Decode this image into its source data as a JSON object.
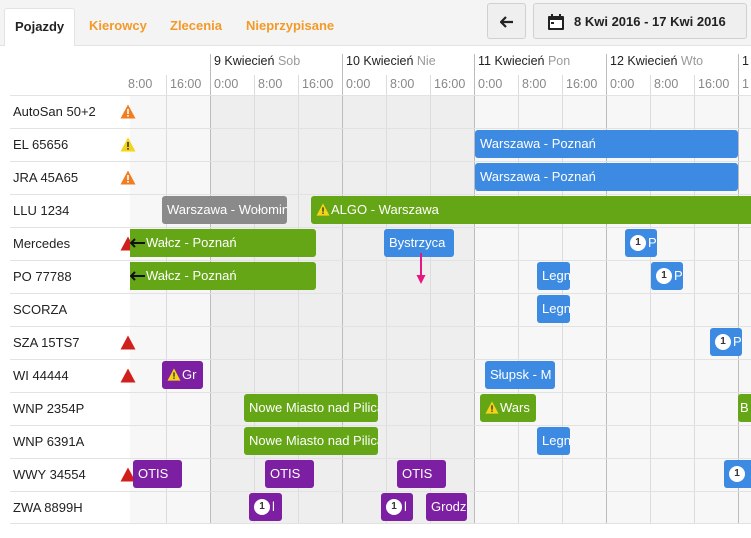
{
  "tabs": [
    {
      "label": "Pojazdy",
      "active": true
    },
    {
      "label": "Kierowcy",
      "active": false
    },
    {
      "label": "Zlecenia",
      "active": false
    },
    {
      "label": "Nieprzypisane",
      "active": false
    }
  ],
  "toolbar": {
    "back_icon": "arrow-left-icon",
    "range_icon": "calendar-icon",
    "range_label": "8 Kwi 2016 - 17 Kwi 2016"
  },
  "timeline": {
    "days": [
      {
        "date": "9 Kwiecień",
        "weekday": "Sob"
      },
      {
        "date": "10 Kwiecień",
        "weekday": "Nie"
      },
      {
        "date": "11 Kwiecień",
        "weekday": "Pon"
      },
      {
        "date": "12 Kwiecień",
        "weekday": "Wto"
      },
      {
        "date": "1",
        "weekday": ""
      }
    ],
    "hours": [
      "8:00",
      "16:00",
      "0:00",
      "8:00",
      "16:00",
      "0:00",
      "8:00",
      "16:00",
      "0:00",
      "8:00",
      "16:00",
      "0:00",
      "8:00",
      "16:00",
      "1"
    ]
  },
  "vehicles": [
    {
      "name": "AutoSan 50+2",
      "warning": "orange"
    },
    {
      "name": "EL 65656",
      "warning": "yellow"
    },
    {
      "name": "JRA 45A65",
      "warning": "orange"
    },
    {
      "name": "LLU 1234",
      "warning": ""
    },
    {
      "name": "Mercedes",
      "warning": "red"
    },
    {
      "name": "PO 77788",
      "warning": ""
    },
    {
      "name": "SCORZA",
      "warning": ""
    },
    {
      "name": "SZA 15TS7",
      "warning": "red"
    },
    {
      "name": "WI 44444",
      "warning": "red"
    },
    {
      "name": "WNP 2354P",
      "warning": ""
    },
    {
      "name": "WNP 6391A",
      "warning": ""
    },
    {
      "name": "WWY 34554",
      "warning": "red"
    },
    {
      "name": "ZWA 8899H",
      "warning": ""
    }
  ],
  "events": {
    "el_1": "Warszawa - Poznań",
    "jra_1": "Warszawa - Poznań",
    "llu_1": "Warszawa - Wołomin",
    "llu_2": "ALGO - Warszawa",
    "merc_1": "Wałcz - Poznań",
    "merc_2": "Bystrzyca",
    "merc_3_badge": "1",
    "merc_3": "P",
    "po_1": "Wałcz - Poznań",
    "po_2": "Legn",
    "po_3_badge": "1",
    "po_3": "P",
    "sco_1": "Legn",
    "sza_1_badge": "1",
    "sza_1": "P",
    "wi_1": "Gr",
    "wi_2": "Słupsk - M",
    "wnp1_1": "Nowe Miasto nad Pilicą",
    "wnp1_2": "Wars",
    "wnp1_3": "B",
    "wnp2_1": "Nowe Miasto nad Pilicą",
    "wnp2_2": "Legn",
    "wwy_1": "OTIS",
    "wwy_2": "OTIS",
    "wwy_3": "OTIS",
    "wwy_4_badge": "1",
    "wwy_4": "",
    "zwa_1_badge": "1",
    "zwa_1": "l",
    "zwa_2_badge": "1",
    "zwa_2": "l",
    "zwa_3": "Grodz"
  },
  "colors": {
    "accent_tab": "#f39a28",
    "event_gray": "#8a8a8a",
    "event_green": "#65a616",
    "event_blue": "#3d8ae2",
    "event_purple": "#7c1fa3",
    "warning_red": "#d0201d",
    "warning_orange": "#f07d22",
    "warning_yellow": "#f5d316",
    "marker": "#e6187f"
  }
}
